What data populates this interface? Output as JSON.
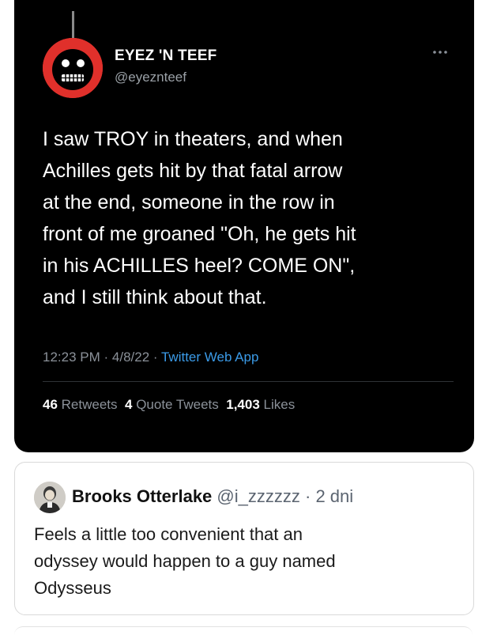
{
  "tweet": {
    "author_name": "EYEZ 'N TEEF",
    "author_handle": "@eyeznteef",
    "more_icon": "ellipsis-icon",
    "text": "I saw TROY in theaters, and when\nAchilles gets hit by that fatal arrow\nat the end, someone in the row in\nfront of me groaned \"Oh, he gets hit\nin his ACHILLES heel? COME ON\",\nand I still think about that.",
    "time": "12:23 PM",
    "date": "4/8/22",
    "source": "Twitter Web App",
    "retweets_count": "46",
    "retweets_label": "Retweets",
    "quote_count": "4",
    "quote_label": "Quote Tweets",
    "likes_count": "1,403",
    "likes_label": "Likes"
  },
  "reply": {
    "author_name": "Brooks Otterlake",
    "author_handle": "@i_zzzzzz",
    "age": "2 dni",
    "text": "Feels a little too convenient that an\nodyssey would happen to a guy named\nOdysseus"
  },
  "colors": {
    "tweet_bg": "#000000",
    "avatar_red": "#e0302b",
    "link_blue": "#3b9be8",
    "muted_text": "#8b9199"
  }
}
